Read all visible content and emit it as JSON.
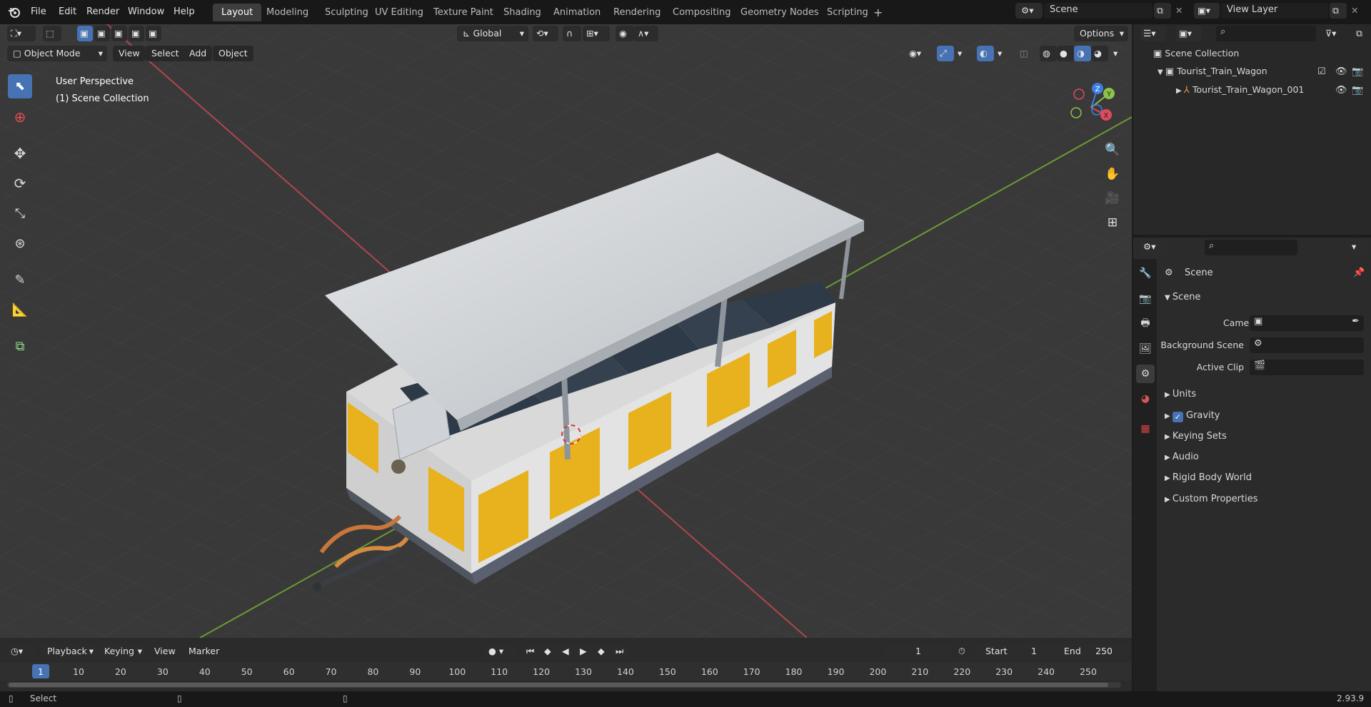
{
  "menubar": {
    "items": [
      "File",
      "Edit",
      "Render",
      "Window",
      "Help"
    ],
    "workspaces": [
      "Layout",
      "Modeling",
      "Sculpting",
      "UV Editing",
      "Texture Paint",
      "Shading",
      "Animation",
      "Rendering",
      "Compositing",
      "Geometry Nodes",
      "Scripting"
    ],
    "active_workspace": "Layout",
    "add_tab": "+",
    "scene_label": "Scene",
    "view_layer_label": "View Layer"
  },
  "viewport_header": {
    "orientation": "Global",
    "options_label": "Options",
    "mode_label": "Object Mode",
    "menus": [
      "View",
      "Select",
      "Add",
      "Object"
    ]
  },
  "viewport": {
    "perspective_label": "User Perspective",
    "collection_label": "(1) Scene Collection",
    "gizmo_axes": {
      "x": "X",
      "y": "Y",
      "z": "Z"
    },
    "colors": {
      "x_axis": "#e24a5a",
      "y_axis": "#8bc34a",
      "z_axis": "#3d7ee0",
      "bg": "#393939",
      "grid": "#4a4a4a"
    }
  },
  "outliner": {
    "root": "Scene Collection",
    "items": [
      {
        "label": "Tourist_Train_Wagon",
        "type": "collection"
      },
      {
        "label": "Tourist_Train_Wagon_001",
        "type": "object"
      }
    ]
  },
  "properties": {
    "context_label": "Scene",
    "panel_title": "Scene",
    "fields": [
      {
        "label": "Camera",
        "value": ""
      },
      {
        "label": "Background Scene",
        "value": ""
      },
      {
        "label": "Active Clip",
        "value": ""
      }
    ],
    "sections": [
      "Units",
      "Gravity",
      "Keying Sets",
      "Audio",
      "Rigid Body World",
      "Custom Properties"
    ],
    "gravity_checked": true
  },
  "timeline": {
    "menus": [
      "Playback",
      "Keying",
      "View",
      "Marker"
    ],
    "current_frame": "1",
    "start_label": "Start",
    "start_value": "1",
    "end_label": "End",
    "end_value": "250",
    "ticks": [
      "1",
      "10",
      "20",
      "30",
      "40",
      "50",
      "60",
      "70",
      "80",
      "90",
      "100",
      "110",
      "120",
      "130",
      "140",
      "150",
      "160",
      "170",
      "180",
      "190",
      "200",
      "210",
      "220",
      "230",
      "240",
      "250"
    ]
  },
  "statusbar": {
    "select_label": "Select",
    "version": "2.93.9"
  }
}
